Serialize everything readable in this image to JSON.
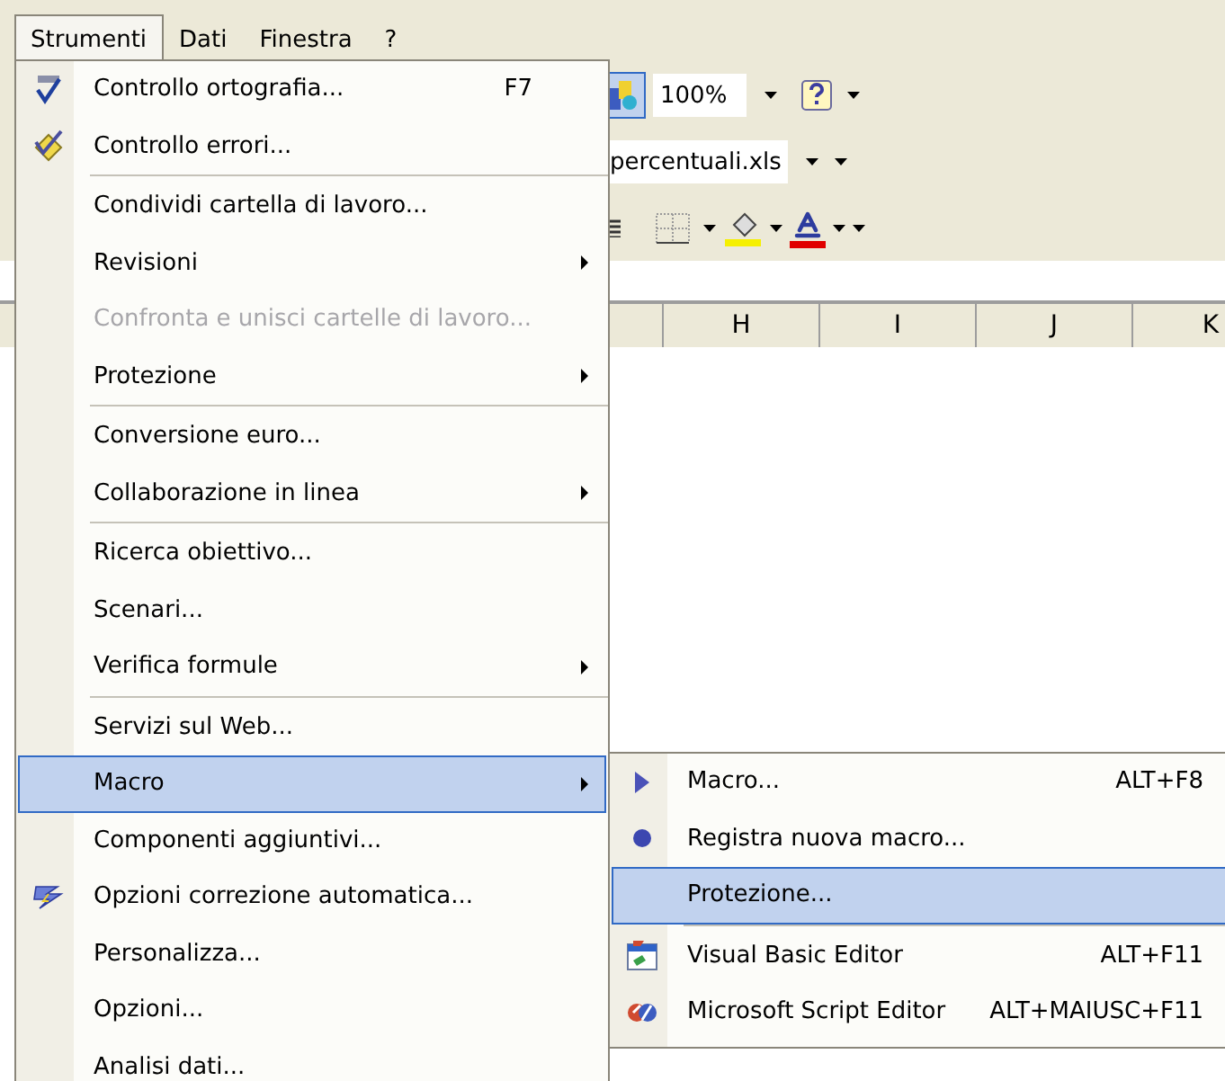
{
  "menubar": [
    {
      "label": "Strumenti",
      "selected": true
    },
    {
      "label": "Dati",
      "selected": false
    },
    {
      "label": "Finestra",
      "selected": false
    },
    {
      "label": "?",
      "selected": false
    }
  ],
  "toolbar": {
    "zoom": "100%",
    "workbook": "percentuali.xls"
  },
  "column_headers": [
    "H",
    "I",
    "J",
    "K"
  ],
  "menu": {
    "items": [
      {
        "kind": "item",
        "label": "Controllo ortografia...",
        "shortcut": "F7",
        "submenu": false,
        "disabled": false,
        "selected": false
      },
      {
        "kind": "item",
        "label": "Controllo errori...",
        "submenu": false,
        "disabled": false,
        "selected": false
      },
      {
        "kind": "separator"
      },
      {
        "kind": "item",
        "label": "Condividi cartella di lavoro...",
        "submenu": false,
        "disabled": false,
        "selected": false
      },
      {
        "kind": "item",
        "label": "Revisioni",
        "submenu": true,
        "disabled": false,
        "selected": false
      },
      {
        "kind": "item",
        "label": "Confronta e unisci cartelle di lavoro...",
        "submenu": false,
        "disabled": true,
        "selected": false
      },
      {
        "kind": "item",
        "label": "Protezione",
        "submenu": true,
        "disabled": false,
        "selected": false
      },
      {
        "kind": "separator"
      },
      {
        "kind": "item",
        "label": "Conversione euro...",
        "submenu": false,
        "disabled": false,
        "selected": false
      },
      {
        "kind": "item",
        "label": "Collaborazione in linea",
        "submenu": true,
        "disabled": false,
        "selected": false
      },
      {
        "kind": "separator"
      },
      {
        "kind": "item",
        "label": "Ricerca obiettivo...",
        "submenu": false,
        "disabled": false,
        "selected": false
      },
      {
        "kind": "item",
        "label": "Scenari...",
        "submenu": false,
        "disabled": false,
        "selected": false
      },
      {
        "kind": "item",
        "label": "Verifica formule",
        "submenu": true,
        "disabled": false,
        "selected": false
      },
      {
        "kind": "separator"
      },
      {
        "kind": "item",
        "label": "Servizi sul Web...",
        "submenu": false,
        "disabled": false,
        "selected": false
      },
      {
        "kind": "item",
        "label": "Macro",
        "submenu": true,
        "disabled": false,
        "selected": true
      },
      {
        "kind": "item",
        "label": "Componenti aggiuntivi...",
        "submenu": false,
        "disabled": false,
        "selected": false
      },
      {
        "kind": "item",
        "label": "Opzioni correzione automatica...",
        "submenu": false,
        "disabled": false,
        "selected": false
      },
      {
        "kind": "item",
        "label": "Personalizza...",
        "submenu": false,
        "disabled": false,
        "selected": false
      },
      {
        "kind": "item",
        "label": "Opzioni...",
        "submenu": false,
        "disabled": false,
        "selected": false
      },
      {
        "kind": "item",
        "label": "Analisi dati...",
        "submenu": false,
        "disabled": false,
        "selected": false
      }
    ]
  },
  "submenu": {
    "items": [
      {
        "kind": "item",
        "label": "Macro...",
        "shortcut": "ALT+F8",
        "selected": false
      },
      {
        "kind": "item",
        "label": "Registra nuova macro...",
        "selected": false
      },
      {
        "kind": "item",
        "label": "Protezione...",
        "selected": true
      },
      {
        "kind": "separator"
      },
      {
        "kind": "item",
        "label": "Visual Basic Editor",
        "shortcut": "ALT+F11",
        "selected": false
      },
      {
        "kind": "item",
        "label": "Microsoft Script Editor",
        "shortcut": "ALT+MAIUSC+F11",
        "selected": false
      }
    ]
  }
}
